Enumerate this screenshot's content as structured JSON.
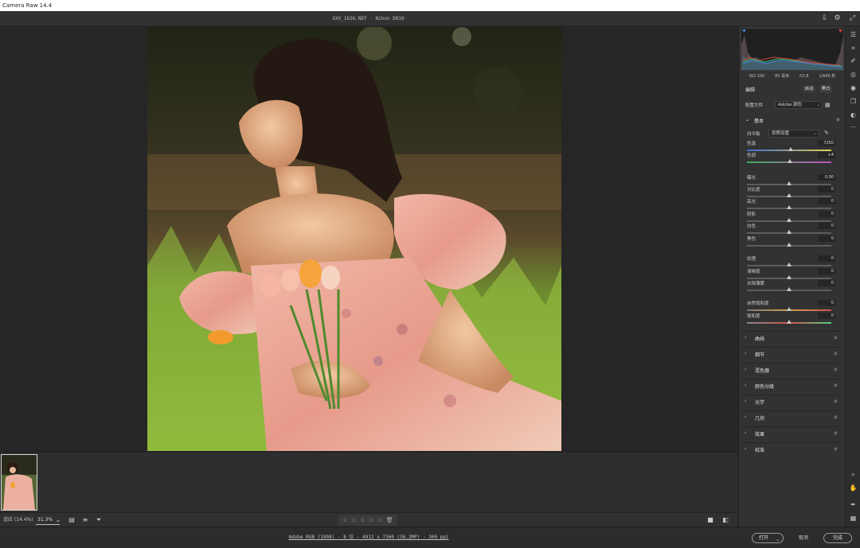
{
  "app": {
    "title": "Camera Raw 14.4"
  },
  "file": {
    "title": "XXX_1636.NEF  ·  Nikon D810"
  },
  "panel": {
    "camera_meta": [
      "ISO 100",
      "85 毫米",
      "f/2.8",
      "1/640 秒"
    ],
    "edit_label": "编辑",
    "auto_label": "自动",
    "bw_label": "黑白",
    "profile_label": "配置文件",
    "profile_value": "Adobe 颜色",
    "basic_title": "基本",
    "wb_label": "白平衡",
    "wb_value": "原照设置",
    "sliders": [
      {
        "label": "色温",
        "value": "7250",
        "pos": 0.52,
        "track": "temp"
      },
      {
        "label": "色调",
        "value": "+4",
        "pos": 0.51,
        "track": "tint"
      },
      {
        "label": "曝光",
        "value": "0.00",
        "pos": 0.5,
        "track": "plain"
      },
      {
        "label": "对比度",
        "value": "0",
        "pos": 0.5,
        "track": "plain"
      },
      {
        "label": "高光",
        "value": "0",
        "pos": 0.5,
        "track": "plain"
      },
      {
        "label": "阴影",
        "value": "0",
        "pos": 0.5,
        "track": "plain"
      },
      {
        "label": "白色",
        "value": "0",
        "pos": 0.5,
        "track": "plain"
      },
      {
        "label": "黑色",
        "value": "0",
        "pos": 0.5,
        "track": "plain"
      },
      {
        "label": "纹理",
        "value": "0",
        "pos": 0.5,
        "track": "plain"
      },
      {
        "label": "清晰度",
        "value": "0",
        "pos": 0.5,
        "track": "plain"
      },
      {
        "label": "去除薄雾",
        "value": "0",
        "pos": 0.5,
        "track": "plain"
      },
      {
        "label": "自然饱和度",
        "value": "0",
        "pos": 0.5,
        "track": "vib"
      },
      {
        "label": "饱和度",
        "value": "0",
        "pos": 0.5,
        "track": "sat"
      }
    ],
    "sections": [
      "曲线",
      "细节",
      "混色器",
      "颜色分级",
      "光学",
      "几何",
      "效果",
      "校准"
    ]
  },
  "bottom": {
    "fit_label": "适应 (14.4%)",
    "zoom_value": "31.3%"
  },
  "status": {
    "file_info": "Adobe RGB (1998) - 8 位 - 4912 x 7360 (36.2MP) - 300 ppi",
    "open_label": "打开",
    "cancel_label": "取消",
    "done_label": "完成"
  },
  "colors": {
    "accent": "#cfcfcf",
    "panel_bg": "#323232",
    "canvas_bg": "#262626"
  }
}
